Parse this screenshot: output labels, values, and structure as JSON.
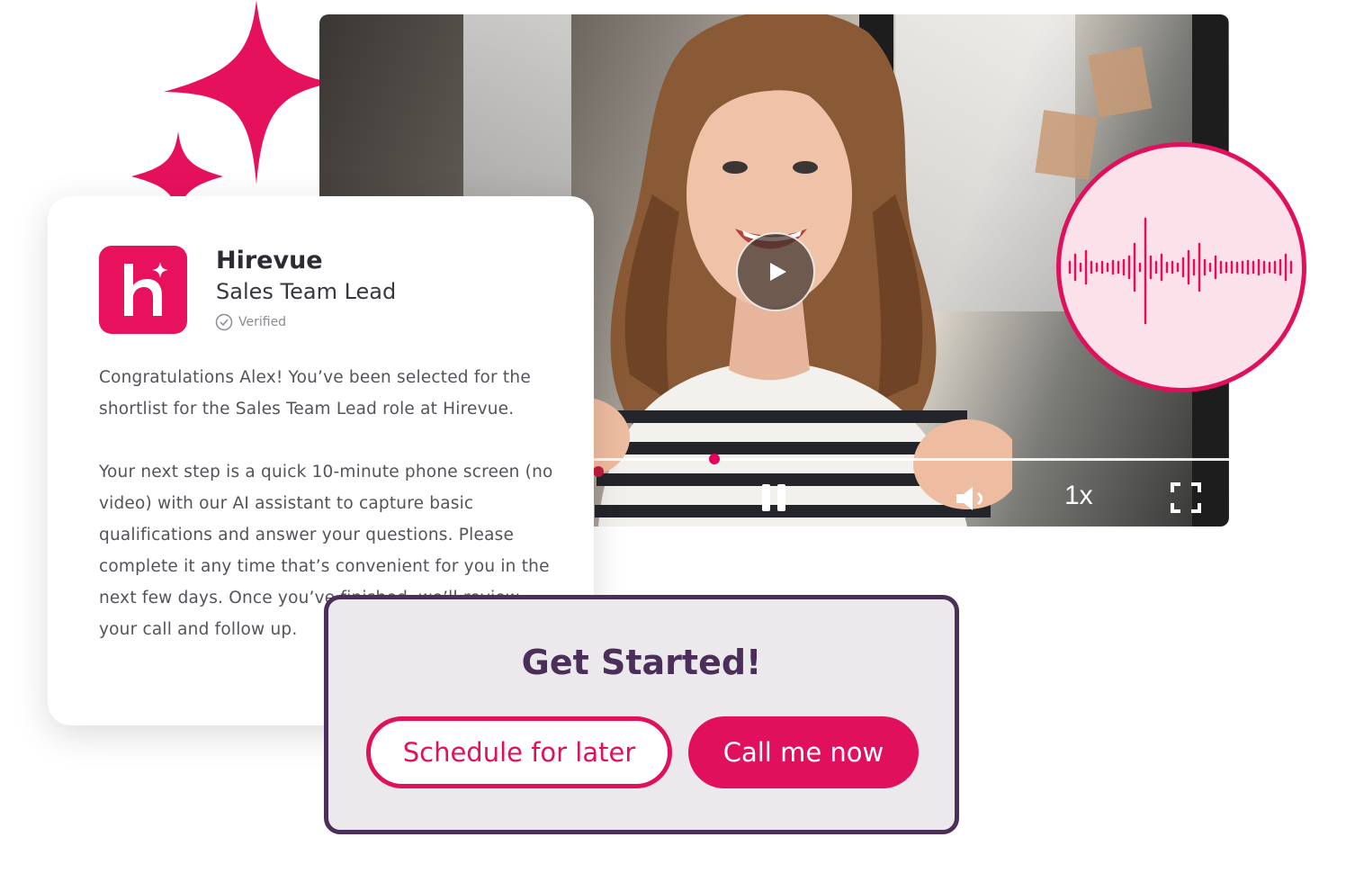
{
  "colors": {
    "brand_pink": "#e0105c",
    "brand_purple": "#4b2e5a",
    "audio_bg": "#fbe2ea"
  },
  "card": {
    "company": "Hirevue",
    "role": "Sales Team Lead",
    "verified_label": "Verified",
    "logo_icon": "hirevue-logo",
    "message_p1": "Congratulations Alex! You’ve been selected for the shortlist for the Sales Team Lead role at Hirevue.",
    "message_p2": "Your next step is a quick 10-minute phone screen (no video) with our AI assistant to capture basic qualifications and answer your questions. Please complete it any time that’s convenient for you in the next few days. Once you’ve finished, we’ll review your call and follow up."
  },
  "video": {
    "playback_speed": "1x",
    "progress": 0.19,
    "icons": [
      "play-icon",
      "pause-icon",
      "volume-icon",
      "fullscreen-icon"
    ]
  },
  "audio": {
    "icon": "waveform-icon"
  },
  "get_started": {
    "title": "Get Started!",
    "schedule_label": "Schedule for later",
    "call_label": "Call me now"
  },
  "decor": {
    "icon": "sparkle-icon"
  }
}
